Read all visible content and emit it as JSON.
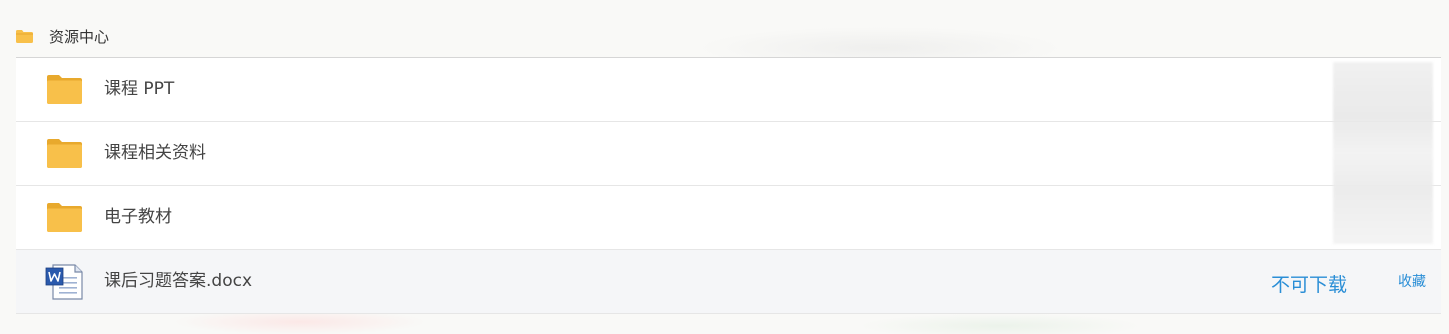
{
  "header": {
    "title": "资源中心",
    "icon": "folder-icon"
  },
  "items": [
    {
      "name": "课程 PPT",
      "type": "folder",
      "icon": "folder-icon"
    },
    {
      "name": "课程相关资料",
      "type": "folder",
      "icon": "folder-icon"
    },
    {
      "name": "电子教材",
      "type": "folder",
      "icon": "folder-icon"
    },
    {
      "name": "课后习题答案.docx",
      "type": "file",
      "icon": "word-document-icon",
      "status": "不可下载",
      "action": "收藏"
    }
  ],
  "colors": {
    "folder": "#f8c04a",
    "folder_dark": "#e8a92d",
    "link": "#2a8ed6"
  }
}
